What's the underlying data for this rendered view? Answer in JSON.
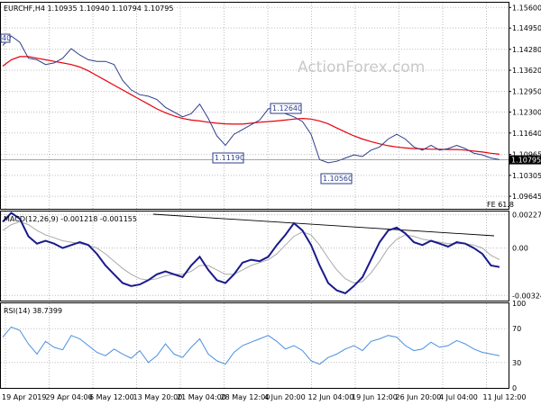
{
  "watermark": "ActionForex.com",
  "colors": {
    "price": "#2c3e8c",
    "ma": "#e8000b",
    "signal": "#aaaaaa",
    "macd": "#1a1a8c",
    "rsi": "#4a8fe0",
    "trend": "#000000",
    "grid": "#bdbdbd",
    "current": "#6e6e6e"
  },
  "chart_data": [
    {
      "type": "line",
      "title": "EURCHF,H4  1.10935 1.10940 1.10794 1.10795",
      "ylim": [
        1.0925,
        1.1575
      ],
      "yticks": [
        "1.15600",
        "1.14950",
        "1.14280",
        "1.13620",
        "1.12950",
        "1.12300",
        "1.11640",
        "1.10965",
        "1.10305",
        "1.09645"
      ],
      "current_label": "1.10795",
      "fe_label": "FE 61.8",
      "left_edge_label": "40",
      "annotations": [
        {
          "text": "1.11190",
          "value": 1.1119
        },
        {
          "text": "1.12640",
          "value": 1.1264
        },
        {
          "text": "1.10560",
          "value": 1.1056
        }
      ],
      "series": [
        {
          "values": [
            1.144,
            1.147,
            1.145,
            1.14,
            1.1395,
            1.138,
            1.1385,
            1.14,
            1.143,
            1.141,
            1.1395,
            1.139,
            1.139,
            1.138,
            1.133,
            1.13,
            1.1285,
            1.128,
            1.127,
            1.1245,
            1.123,
            1.1215,
            1.1225,
            1.1255,
            1.121,
            1.1155,
            1.1125,
            1.116,
            1.1175,
            1.119,
            1.1205,
            1.124,
            1.1245,
            1.1225,
            1.1215,
            1.12,
            1.116,
            1.108,
            1.107,
            1.1075,
            1.1085,
            1.1095,
            1.109,
            1.111,
            1.112,
            1.1145,
            1.116,
            1.1145,
            1.112,
            1.111,
            1.1125,
            1.111,
            1.1115,
            1.1125,
            1.1115,
            1.11,
            1.1095,
            1.1085,
            1.108
          ]
        },
        {
          "values": [
            1.1375,
            1.1395,
            1.1405,
            1.1405,
            1.14,
            1.1395,
            1.139,
            1.1385,
            1.138,
            1.1372,
            1.136,
            1.1345,
            1.133,
            1.1315,
            1.13,
            1.1285,
            1.127,
            1.1255,
            1.124,
            1.1228,
            1.1218,
            1.121,
            1.1205,
            1.1202,
            1.1198,
            1.1195,
            1.1193,
            1.1192,
            1.1192,
            1.1195,
            1.1198,
            1.12,
            1.1202,
            1.1205,
            1.1208,
            1.121,
            1.1208,
            1.1202,
            1.1193,
            1.118,
            1.1167,
            1.1155,
            1.1145,
            1.1137,
            1.113,
            1.1124,
            1.112,
            1.1117,
            1.1115,
            1.1114,
            1.1113,
            1.1113,
            1.1112,
            1.1112,
            1.111,
            1.1107,
            1.1104,
            1.11,
            1.1097
          ]
        }
      ]
    },
    {
      "type": "line",
      "title": "MACD(12,26,9) -0.001218 -0.001155",
      "ylim": [
        -0.0036,
        0.0025
      ],
      "yticks": [
        "0.002276",
        "0.00",
        "-0.003246"
      ],
      "series": [
        {
          "values": [
            0.0018,
            0.0024,
            0.002,
            0.0008,
            0.0003,
            0.0005,
            0.0003,
            0.0,
            0.0002,
            0.0004,
            0.0002,
            -0.0004,
            -0.0012,
            -0.0018,
            -0.0024,
            -0.0026,
            -0.0025,
            -0.0022,
            -0.0018,
            -0.0016,
            -0.0018,
            -0.002,
            -0.0012,
            -0.0006,
            -0.0015,
            -0.0022,
            -0.0024,
            -0.0018,
            -0.001,
            -0.0008,
            -0.0009,
            -0.0006,
            0.0002,
            0.0009,
            0.0017,
            0.0012,
            0.0002,
            -0.0012,
            -0.0024,
            -0.0029,
            -0.0031,
            -0.0026,
            -0.002,
            -0.0008,
            0.0004,
            0.0012,
            0.0014,
            0.001,
            0.0004,
            0.0002,
            0.0005,
            0.0003,
            0.0001,
            0.0004,
            0.0003,
            0.0,
            -0.0004,
            -0.0012,
            -0.0013
          ]
        },
        {
          "values": [
            0.0012,
            0.0016,
            0.0018,
            0.0016,
            0.0012,
            0.0009,
            0.0007,
            0.0005,
            0.0004,
            0.0003,
            0.0002,
            0.0,
            -0.0004,
            -0.0009,
            -0.0014,
            -0.0018,
            -0.0021,
            -0.0022,
            -0.0021,
            -0.0019,
            -0.0018,
            -0.0018,
            -0.0016,
            -0.0012,
            -0.0012,
            -0.0015,
            -0.0018,
            -0.0018,
            -0.0015,
            -0.0012,
            -0.001,
            -0.0008,
            -0.0004,
            0.0002,
            0.0008,
            0.0011,
            0.0009,
            0.0002,
            -0.0007,
            -0.0015,
            -0.0021,
            -0.0024,
            -0.0023,
            -0.0017,
            -0.0009,
            0.0,
            0.0006,
            0.0009,
            0.0008,
            0.0006,
            0.0005,
            0.0004,
            0.0003,
            0.0003,
            0.0003,
            0.0002,
            0.0,
            -0.0005,
            -0.0008
          ]
        }
      ]
    },
    {
      "type": "line",
      "title": "RSI(14) 38.7399",
      "ylim": [
        0,
        100
      ],
      "yticks": [
        "100",
        "70",
        "30",
        "0"
      ],
      "series": [
        {
          "values": [
            60,
            72,
            68,
            52,
            40,
            55,
            48,
            45,
            62,
            58,
            50,
            42,
            38,
            46,
            40,
            35,
            44,
            30,
            38,
            52,
            40,
            36,
            48,
            58,
            40,
            32,
            28,
            42,
            50,
            54,
            58,
            62,
            55,
            46,
            50,
            44,
            32,
            28,
            36,
            40,
            46,
            50,
            44,
            55,
            58,
            62,
            60,
            50,
            44,
            46,
            54,
            48,
            50,
            56,
            52,
            46,
            42,
            40,
            38
          ]
        }
      ]
    }
  ],
  "x_axis": {
    "ticks": [
      "19 Apr 2019",
      "29 Apr 04:00",
      "6 May 12:00",
      "13 May 20:00",
      "21 May 04:00",
      "28 May 12:00",
      "4 Jun 20:00",
      "12 Jun 04:00",
      "19 Jun 12:00",
      "26 Jun 20:00",
      "4 Jul 04:00",
      "11 Jul 12:00"
    ]
  }
}
